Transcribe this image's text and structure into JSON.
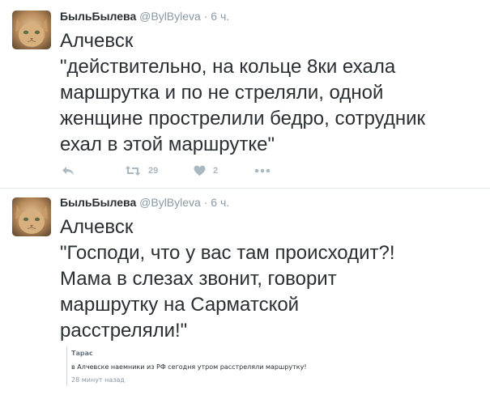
{
  "tweets": [
    {
      "fullname": "БыльБылева",
      "username": "@BylByleva",
      "separator": "·",
      "time": "6 ч.",
      "lines": [
        "Алчевск",
        "\"действительно, на кольце 8ки ехала",
        "маршрутка и по не стреляли, одной",
        "женщине прострелили бедро, сотрудник",
        "ехал в этой маршрутке\""
      ],
      "retweet_count": "29",
      "like_count": "2"
    },
    {
      "fullname": "БыльБылева",
      "username": "@BylByleva",
      "separator": "·",
      "time": "6 ч.",
      "lines": [
        "Алчевск",
        "\"Господи, что у вас там происходит?!",
        "Мама в слезах звонит, говорит",
        "маршрутку на Сарматской",
        "расстреляли!\""
      ],
      "quote": {
        "author": "Тарас",
        "text": "в Алчевске наемники из РФ сегодня утром расстреляли маршрутку!",
        "time": "28 минут назад"
      }
    }
  ],
  "icons": {
    "reply": "reply-arrow-icon",
    "retweet": "retweet-icon",
    "like": "heart-icon",
    "more": "more-dots-icon"
  },
  "colors": {
    "text": "#292f33",
    "muted": "#8899a6",
    "action": "#aab8c2",
    "divider": "#e1e8ed"
  }
}
